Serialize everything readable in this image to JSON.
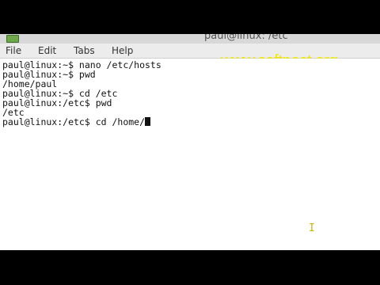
{
  "window": {
    "title": "paul@linux: /etc"
  },
  "menu": {
    "items": [
      "File",
      "Edit",
      "Tabs",
      "Help"
    ]
  },
  "watermark": "www.softpost.org",
  "terminal": {
    "lines": [
      "paul@linux:~$ nano /etc/hosts",
      "paul@linux:~$ pwd",
      "/home/paul",
      "paul@linux:~$ cd /etc",
      "paul@linux:/etc$ pwd",
      "/etc",
      "paul@linux:/etc$ cd /home/"
    ]
  },
  "colors": {
    "watermark": "#f2e800",
    "titlebar": "#d8d8d8",
    "menubar": "#ececec",
    "terminal_bg": "#ffffff",
    "terminal_fg": "#111111"
  },
  "icons": {
    "app": "terminal-icon",
    "pointer": "text-cursor-icon"
  }
}
